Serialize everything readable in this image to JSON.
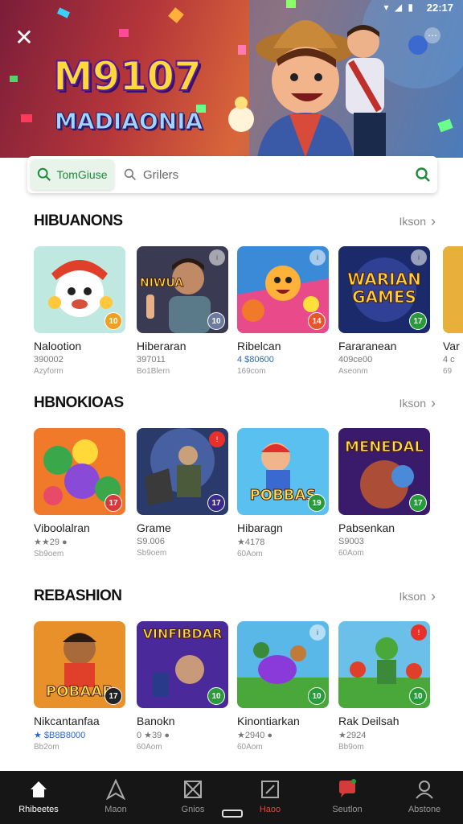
{
  "status_bar": {
    "time": "22:17",
    "icons": "▾ ◢ ▮"
  },
  "hero": {
    "logo": "M9107",
    "subtitle": "MADIAONIA",
    "logo_accent": "G",
    "menu_glyph": "⋯"
  },
  "search": {
    "tab_label": "TomGiuse",
    "placeholder": "Grilers"
  },
  "sections": [
    {
      "title": "HIBUANONS",
      "see_more": "Ikson",
      "cards": [
        {
          "name": "Nalootion",
          "meta": "390002",
          "size": "Azyform",
          "badge": "10",
          "badge_color": "#f0a020"
        },
        {
          "name": "Hiberaran",
          "meta": "397011",
          "size": "Bo1Blern",
          "badge": "10",
          "badge_color": "#6b7ba0",
          "thumb_text": "NIWUA"
        },
        {
          "name": "Ribelcan",
          "meta": "4 $80600",
          "size": "169com",
          "badge": "14",
          "badge_color": "#e8552a",
          "meta_blue": true
        },
        {
          "name": "Fararanean",
          "meta": "409ce00",
          "size": "Aseonm",
          "badge": "17",
          "badge_color": "#2a9a3a",
          "thumb_text": "WARIAN GAMES"
        },
        {
          "name": "Var",
          "meta": "4 c",
          "size": "69",
          "badge": "",
          "badge_color": "#2a9a3a"
        }
      ]
    },
    {
      "title": "HBNOKIOAS",
      "see_more": "Ikson",
      "cards": [
        {
          "name": "Viboolalran",
          "meta": "★★29 ●",
          "size": "Sb9oem",
          "badge": "17",
          "badge_color": "#d63a3a"
        },
        {
          "name": "Grame",
          "meta": "S9.006",
          "size": "Sb9oem",
          "badge": "17",
          "badge_color": "#3a2a8a"
        },
        {
          "name": "Hibaragn",
          "meta": "★4178",
          "size": "60Aom",
          "badge": "19",
          "badge_color": "#2a9a3a",
          "thumb_text": "POBBAS"
        },
        {
          "name": "Pabsenkan",
          "meta": "S9003",
          "size": "60Aom",
          "badge": "17",
          "badge_color": "#2a9a3a",
          "thumb_text": "MENEDAL"
        }
      ]
    },
    {
      "title": "REBASHION",
      "see_more": "Ikson",
      "cards": [
        {
          "name": "Nikcantanfaa",
          "meta": "★ $B8B8000",
          "size": "Bb2om",
          "badge": "17",
          "badge_color": "#222",
          "meta_blue": true,
          "thumb_text": "POBAAR"
        },
        {
          "name": "Banokn",
          "meta": "0 ★39 ●",
          "size": "60Aom",
          "badge": "10",
          "badge_color": "#2a9a3a",
          "thumb_text": "VINFIBDAR"
        },
        {
          "name": "Kinontiarkan",
          "meta": "★2940 ●",
          "size": "60Aom",
          "badge": "10",
          "badge_color": "#2a9a3a"
        },
        {
          "name": "Rak Deilsah",
          "meta": "★2924",
          "size": "Bb9om",
          "badge": "10",
          "badge_color": "#2a9a3a"
        }
      ]
    }
  ],
  "bottom_nav": [
    {
      "label": "Rhibeetes",
      "icon": "home-icon",
      "active": true
    },
    {
      "label": "Maon",
      "icon": "navigate-icon"
    },
    {
      "label": "Gnios",
      "icon": "apps-icon"
    },
    {
      "label": "Haoo",
      "icon": "edit-icon",
      "red": true
    },
    {
      "label": "Seutlon",
      "icon": "chat-icon"
    },
    {
      "label": "Abstone",
      "icon": "person-icon"
    }
  ],
  "colors": {
    "accent_green": "#1e8a3c",
    "nav_bg": "#161616",
    "nav_red": "#e2473e"
  }
}
